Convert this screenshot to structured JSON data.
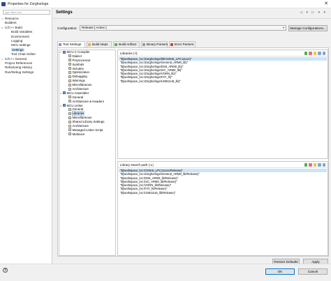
{
  "window": {
    "title": "Properties for Zorghorloge",
    "close_glyph": "✕"
  },
  "left": {
    "filter_placeholder": "type filter text",
    "tree": [
      {
        "label": "Resource",
        "toggle": ">",
        "indent": 0
      },
      {
        "label": "Builders",
        "toggle": "",
        "indent": 0
      },
      {
        "label": "C/C++ Build",
        "toggle": "v",
        "indent": 0
      },
      {
        "label": "Build Variables",
        "toggle": "",
        "indent": 1
      },
      {
        "label": "Environment",
        "toggle": "",
        "indent": 1
      },
      {
        "label": "Logging",
        "toggle": "",
        "indent": 1
      },
      {
        "label": "MCU settings",
        "toggle": "",
        "indent": 1
      },
      {
        "label": "Settings",
        "toggle": "",
        "indent": 1,
        "selected": true
      },
      {
        "label": "Tool Chain Editor",
        "toggle": "",
        "indent": 1
      },
      {
        "label": "C/C++ General",
        "toggle": ">",
        "indent": 0
      },
      {
        "label": "Project References",
        "toggle": "",
        "indent": 0
      },
      {
        "label": "Refactoring History",
        "toggle": "",
        "indent": 0
      },
      {
        "label": "Run/Debug Settings",
        "toggle": "",
        "indent": 0
      }
    ]
  },
  "header": {
    "title": "Settings",
    "nav": "◁ ▾ ▷ ▾ ▾"
  },
  "configuration": {
    "label": "Configuration:",
    "value": "Release [ Active ]",
    "arrow": "▾",
    "manage_label": "Manage Configurations..."
  },
  "tabs": [
    {
      "label": "Tool Settings",
      "color": "#7b95c7"
    },
    {
      "label": "Build steps",
      "color": "#e8b04a"
    },
    {
      "label": "Build Artifact",
      "color": "#6aa84f"
    },
    {
      "label": "Binary Parsers",
      "color": "#999999"
    },
    {
      "label": "Error Parsers",
      "color": "#cc4125"
    }
  ],
  "tool_tree": [
    {
      "label": "MCU C Compiler",
      "toggle": "v",
      "indent": 0,
      "tool": true
    },
    {
      "label": "Dialect",
      "indent": 1
    },
    {
      "label": "Preprocessor",
      "indent": 1
    },
    {
      "label": "Symbols",
      "indent": 1
    },
    {
      "label": "Includes",
      "indent": 1
    },
    {
      "label": "Optimization",
      "indent": 1
    },
    {
      "label": "Debugging",
      "indent": 1
    },
    {
      "label": "Warnings",
      "indent": 1
    },
    {
      "label": "Miscellaneous",
      "indent": 1
    },
    {
      "label": "Architecture",
      "indent": 1
    },
    {
      "label": "MCU Assembler",
      "toggle": "v",
      "indent": 0,
      "tool": true
    },
    {
      "label": "General",
      "indent": 1
    },
    {
      "label": "Architecture & Headers",
      "indent": 1
    },
    {
      "label": "MCU Linker",
      "toggle": "v",
      "indent": 0,
      "tool": true
    },
    {
      "label": "General",
      "indent": 1
    },
    {
      "label": "Libraries",
      "indent": 1,
      "selected": true
    },
    {
      "label": "Miscellaneous",
      "indent": 1
    },
    {
      "label": "Shared Library Settings",
      "indent": 1
    },
    {
      "label": "Architecture",
      "indent": 1
    },
    {
      "label": "Managed Linker Script",
      "indent": 1
    },
    {
      "label": "Multicore",
      "indent": 1
    }
  ],
  "libraries": {
    "header": "Libraries (-l)",
    "items": [
      "\"${workspace_loc:/Zorghorloge/lib/CMSIS_LPC11Uxx}\"",
      "\"${workspace_loc:/Zorghorloge/General_ARM0_lib}\"",
      "\"${workspace_loc:/Zorghorloge/DS5_ARM0_lib}\"",
      "\"${workspace_loc:/Zorghorloge/I2C_ARM0_lib}\"",
      "\"${workspace_loc:/Zorghorloge/VORN_lib}\"",
      "\"${workspace_loc:/Zorghorloge/FAT_fs}\"",
      "\"${workspace_loc:/Zorghorloge/USB11U6_lib}\""
    ]
  },
  "search_path": {
    "header": "Library search path (-L)",
    "items": [
      "\"${workspace_loc:/CMSIS_LPC11Uxx/Release}\"",
      "\"${workspace_loc:/Zorghorloge/General_ARM0_lib/Release}\"",
      "\"${workspace_loc:/DS5_ARM0_lib/Release}\"",
      "\"${workspace_loc:/I2C_ARM0_lib/Release}\"",
      "\"${workspace_loc:/VORN_lib/Release}\"",
      "\"${workspace_loc:/FAT_fs/Release}\"",
      "\"${workspace_loc:/USB11U6_lib/Release}\""
    ]
  },
  "list_icon_colors": [
    "#4caf50",
    "#e57373",
    "#f2c14e",
    "#7aa7d6",
    "#7aa7d6"
  ],
  "buttons": {
    "restore": "Restore Defaults",
    "apply": "Apply",
    "ok": "OK",
    "cancel": "Cancel",
    "help": "?"
  }
}
